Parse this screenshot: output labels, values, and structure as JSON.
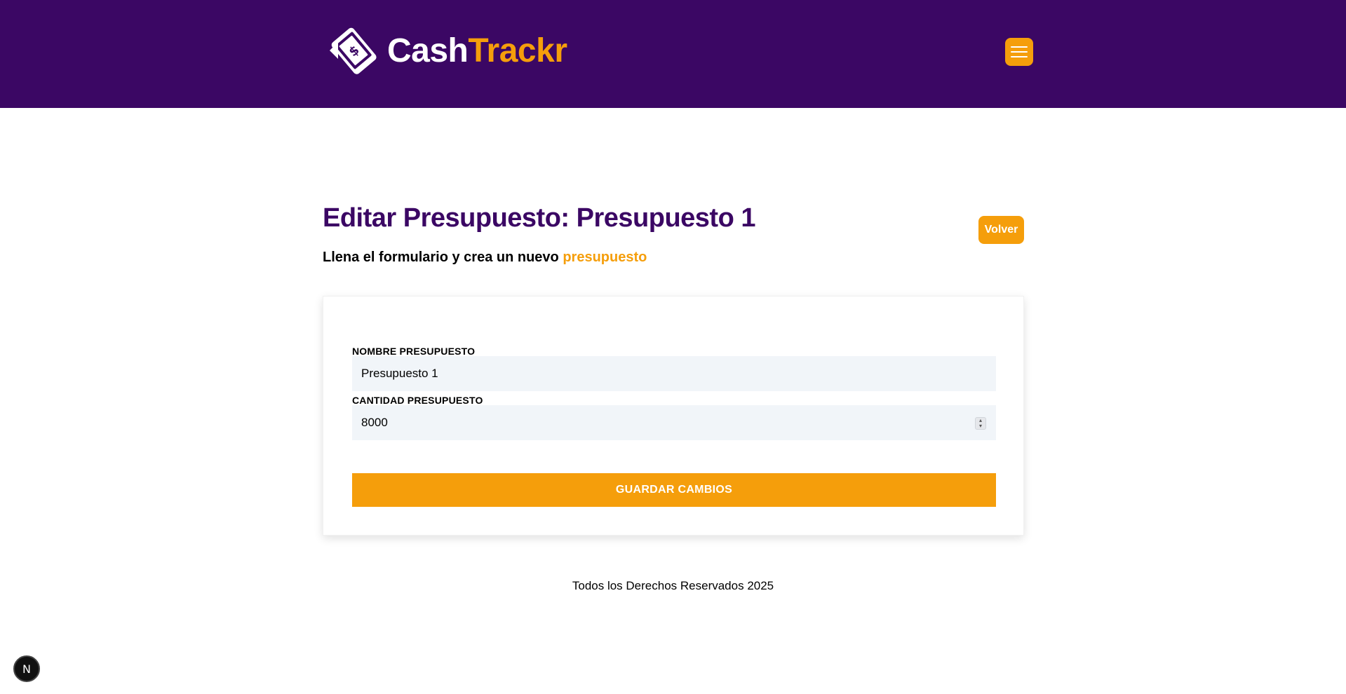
{
  "header": {
    "brand_part1": "Cash",
    "brand_part2": "Trackr",
    "logo_icon": "money-phone-icon",
    "menu_icon": "hamburger-menu-icon"
  },
  "main": {
    "title": "Editar Presupuesto: Presupuesto 1",
    "subtitle_prefix": "Llena el formulario y crea un nuevo ",
    "subtitle_accent": "presupuesto",
    "back_label": "Volver"
  },
  "form": {
    "name_label": "NOMBRE PRESUPUESTO",
    "name_value": "Presupuesto 1",
    "amount_label": "CANTIDAD PRESUPUESTO",
    "amount_value": "8000",
    "submit_label": "GUARDAR CAMBIOS"
  },
  "footer": {
    "text": "Todos los Derechos Reservados 2025"
  },
  "dev_badge": {
    "label": "N"
  },
  "colors": {
    "brand_purple": "#3b0764",
    "accent_amber": "#f59e0b",
    "input_bg": "#f1f5f9"
  }
}
